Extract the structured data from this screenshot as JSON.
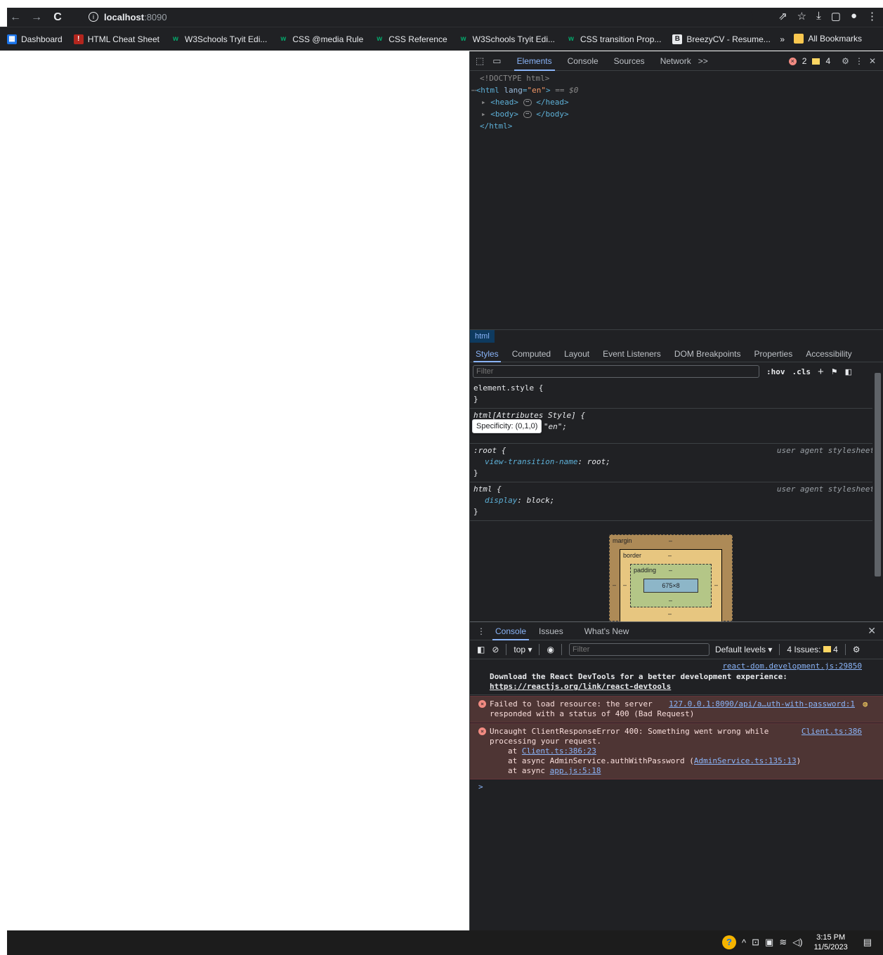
{
  "browser": {
    "url_host": "localhost",
    "url_port": ":8090",
    "bookmarks": [
      {
        "label": "Dashboard",
        "icon": "dashboard-icon"
      },
      {
        "label": "HTML Cheat Sheet",
        "icon": "html-icon"
      },
      {
        "label": "W3Schools Tryit Edi...",
        "icon": "w3schools-icon"
      },
      {
        "label": "CSS @media Rule",
        "icon": "w3schools-icon"
      },
      {
        "label": "CSS Reference",
        "icon": "w3schools-icon"
      },
      {
        "label": "W3Schools Tryit Edi...",
        "icon": "w3schools-icon"
      },
      {
        "label": "CSS transition Prop...",
        "icon": "w3schools-icon"
      },
      {
        "label": "BreezyCV - Resume...",
        "icon": "breezycv-icon"
      }
    ],
    "bookmarks_more": "»",
    "all_bookmarks": "All Bookmarks"
  },
  "devtools": {
    "tabs": [
      "Elements",
      "Console",
      "Sources",
      "Network"
    ],
    "more_tabs": ">>",
    "error_count": "2",
    "warning_count": "4",
    "dom": {
      "doctype": "<!DOCTYPE html>",
      "html_open_tag": "html",
      "html_attr_name": "lang",
      "html_attr_value": "\"en\"",
      "selected_marker": "== $0",
      "head": "head",
      "body": "body",
      "html_close": "</html>"
    },
    "breadcrumb": "html",
    "sub_tabs": [
      "Styles",
      "Computed",
      "Layout",
      "Event Listeners",
      "DOM Breakpoints",
      "Properties",
      "Accessibility"
    ],
    "styles_filter_placeholder": "Filter",
    "styles_buttons": [
      ":hov",
      ".cls",
      "+"
    ],
    "rules": {
      "element_style": "element.style {",
      "attrs_selector": "html[Attributes Style] {",
      "attrs_prop_visible": "e: \"en\";",
      "root_selector": ":root {",
      "root_prop": "view-transition-name",
      "root_value": "root;",
      "html_selector": "html {",
      "html_prop": "display",
      "html_value": "block;",
      "close_brace": "}",
      "origin": "user agent stylesheet"
    },
    "tooltip": "Specificity: (0,1,0)",
    "box_model": {
      "margin": "margin",
      "border": "border",
      "padding": "padding",
      "content": "675×8",
      "dash": "–"
    },
    "drawer": {
      "tabs": [
        "Console",
        "Issues",
        "What's New"
      ],
      "context": "top",
      "filter_placeholder": "Filter",
      "levels": "Default levels",
      "issues_label": "4 Issues:",
      "issues_count": "4"
    },
    "console": [
      {
        "source": "react-dom.development.js:29850",
        "text": "Download the React DevTools for a better development experience: ",
        "link": "https://reactjs.org/link/react-devtools"
      },
      {
        "type": "error",
        "text_a": "Failed to load resource: the server",
        "text_b": "responded with a status of 400 (Bad Request)",
        "source": "127.0.0.1:8090/api/a…uth-with-password:1"
      },
      {
        "type": "error",
        "text_a": "Uncaught ClientResponseError 400: Something went wrong while",
        "text_b": "processing your request.",
        "source": "Client.ts:386",
        "stack1_pre": "at ",
        "stack1_link": "Client.ts:386:23",
        "stack2_pre": "at async AdminService.authWithPassword (",
        "stack2_link": "AdminService.ts:135:13",
        "stack2_post": ")",
        "stack3_pre": "at async ",
        "stack3_link": "app.js:5:18"
      }
    ],
    "prompt": ">"
  },
  "taskbar": {
    "time": "3:15 PM",
    "date": "11/5/2023"
  }
}
